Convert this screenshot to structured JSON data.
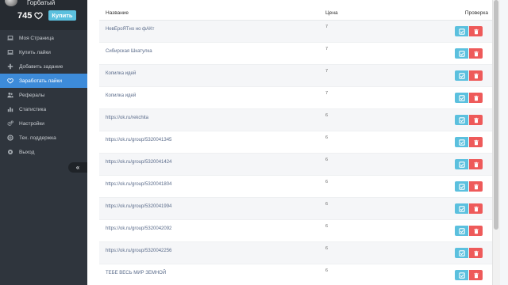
{
  "profile": {
    "username": "Горбатый",
    "balance": "745",
    "buy_label": "Купить"
  },
  "menu": [
    {
      "label": "Моя Страница",
      "icon": "laptop-icon",
      "active": false
    },
    {
      "label": "Купить лайки",
      "icon": "laptop-icon",
      "active": false
    },
    {
      "label": "Добавить задание",
      "icon": "plus-icon",
      "active": false
    },
    {
      "label": "Заработать лайки",
      "icon": "heart-icon",
      "active": true
    },
    {
      "label": "Рефералы",
      "icon": "users-icon",
      "active": false
    },
    {
      "label": "Статистика",
      "icon": "bar-chart-icon",
      "active": false
    },
    {
      "label": "Настройки",
      "icon": "gears-icon",
      "active": false
    },
    {
      "label": "Тех. поддержка",
      "icon": "support-icon",
      "active": false
    },
    {
      "label": "Выход",
      "icon": "logout-icon",
      "active": false
    }
  ],
  "collapse_label": "«",
  "table": {
    "headers": {
      "name": "Название",
      "price": "Цена",
      "check": "Проверка"
    },
    "rows": [
      {
        "name": "НевЕроЯТно но фАКт",
        "price": "7"
      },
      {
        "name": "Сибирская Шкатулка",
        "price": "7"
      },
      {
        "name": "Копилка идей",
        "price": "7"
      },
      {
        "name": "Копилка идей",
        "price": "7"
      },
      {
        "name": "https://ok.ru/rekchita",
        "price": "6"
      },
      {
        "name": "https://ok.ru/group/5320041345",
        "price": "6"
      },
      {
        "name": "https://ok.ru/group/5320041424",
        "price": "6"
      },
      {
        "name": "https://ok.ru/group/5320041804",
        "price": "6"
      },
      {
        "name": "https://ok.ru/group/5320041994",
        "price": "6"
      },
      {
        "name": "https://ok.ru/group/5320042092",
        "price": "6"
      },
      {
        "name": "https://ok.ru/group/5320042256",
        "price": "6"
      },
      {
        "name": "ТЕБЕ ВЕСЬ МИР ЗЕМНОЙ",
        "price": "6"
      }
    ]
  },
  "colors": {
    "sidebar": "#2f353d",
    "active": "#3d8bd9",
    "check_button": "#5bc0de",
    "delete_button": "#ee5a5a"
  }
}
